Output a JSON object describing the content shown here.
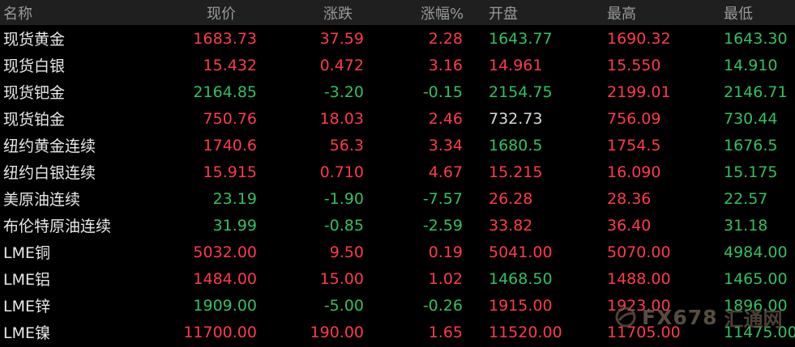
{
  "columns": [
    "名称",
    "现价",
    "涨跌",
    "涨幅%",
    "开盘",
    "最高",
    "最低"
  ],
  "colors": {
    "up": "#ff3b47",
    "down": "#31c15f",
    "flat": "#d8d8d8",
    "header_bg": "#1f1f1f",
    "background": "#000000"
  },
  "rows": [
    {
      "name": "现货黄金",
      "cells": [
        "1683.73",
        "37.59",
        "2.28",
        "1643.77",
        "1690.32",
        "1643.30"
      ],
      "tones": [
        "up",
        "up",
        "up",
        "down",
        "up",
        "down"
      ]
    },
    {
      "name": "现货白银",
      "cells": [
        "15.432",
        "0.472",
        "3.16",
        "14.961",
        "15.550",
        "14.910"
      ],
      "tones": [
        "up",
        "up",
        "up",
        "up",
        "up",
        "down"
      ]
    },
    {
      "name": "现货钯金",
      "cells": [
        "2164.85",
        "-3.20",
        "-0.15",
        "2154.75",
        "2199.01",
        "2146.71"
      ],
      "tones": [
        "down",
        "down",
        "down",
        "down",
        "up",
        "down"
      ]
    },
    {
      "name": "现货铂金",
      "cells": [
        "750.76",
        "18.03",
        "2.46",
        "732.73",
        "756.09",
        "730.44"
      ],
      "tones": [
        "up",
        "up",
        "up",
        "flat",
        "up",
        "down"
      ]
    },
    {
      "name": "纽约黄金连续",
      "cells": [
        "1740.6",
        "56.3",
        "3.34",
        "1680.5",
        "1754.5",
        "1676.5"
      ],
      "tones": [
        "up",
        "up",
        "up",
        "down",
        "up",
        "down"
      ]
    },
    {
      "name": "纽约白银连续",
      "cells": [
        "15.915",
        "0.710",
        "4.67",
        "15.215",
        "16.090",
        "15.175"
      ],
      "tones": [
        "up",
        "up",
        "up",
        "up",
        "up",
        "down"
      ]
    },
    {
      "name": "美原油连续",
      "cells": [
        "23.19",
        "-1.90",
        "-7.57",
        "26.28",
        "28.36",
        "22.57"
      ],
      "tones": [
        "down",
        "down",
        "down",
        "up",
        "up",
        "down"
      ]
    },
    {
      "name": "布伦特原油连续",
      "cells": [
        "31.99",
        "-0.85",
        "-2.59",
        "33.82",
        "36.40",
        "31.18"
      ],
      "tones": [
        "down",
        "down",
        "down",
        "up",
        "up",
        "down"
      ]
    },
    {
      "name": "LME铜",
      "cells": [
        "5032.00",
        "9.50",
        "0.19",
        "5041.00",
        "5070.00",
        "4984.00"
      ],
      "tones": [
        "up",
        "up",
        "up",
        "up",
        "up",
        "down"
      ]
    },
    {
      "name": "LME铝",
      "cells": [
        "1484.00",
        "15.00",
        "1.02",
        "1468.50",
        "1488.00",
        "1465.00"
      ],
      "tones": [
        "up",
        "up",
        "up",
        "down",
        "up",
        "down"
      ]
    },
    {
      "name": "LME锌",
      "cells": [
        "1909.00",
        "-5.00",
        "-0.26",
        "1915.00",
        "1923.00",
        "1896.00"
      ],
      "tones": [
        "down",
        "down",
        "down",
        "up",
        "up",
        "down"
      ]
    },
    {
      "name": "LME镍",
      "cells": [
        "11700.00",
        "190.00",
        "1.65",
        "11520.00",
        "11705.00",
        "11475.00"
      ],
      "tones": [
        "up",
        "up",
        "up",
        "up",
        "up",
        "down"
      ]
    }
  ],
  "watermark": {
    "text": "FX678",
    "cn_text": "汇通网",
    "icon": "globe-logo-icon"
  }
}
